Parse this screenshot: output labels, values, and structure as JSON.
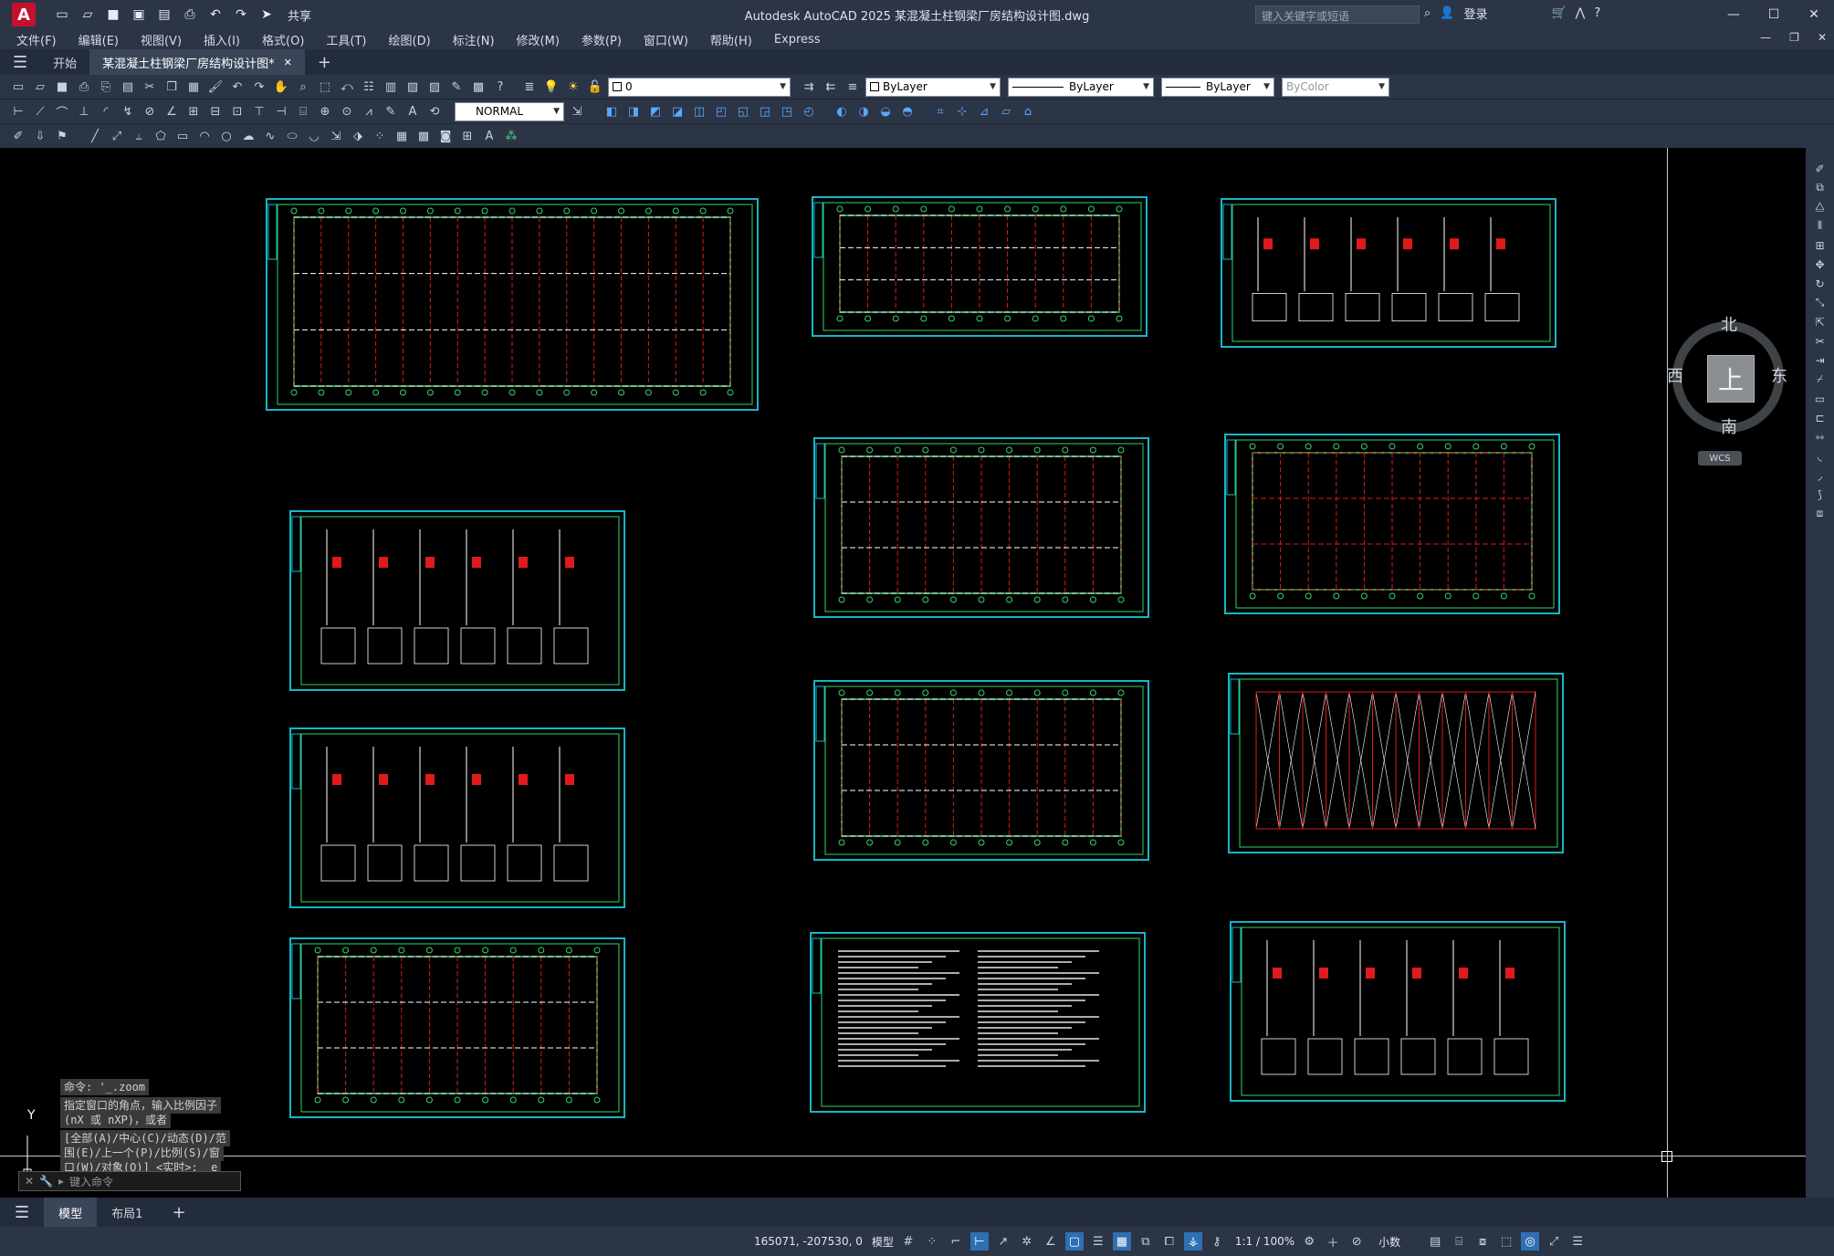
{
  "app": {
    "logo": "A",
    "title": "Autodesk AutoCAD 2025    某混凝土柱钢梁厂房结构设计图.dwg",
    "share_label": "共享",
    "search_placeholder": "键入关键字或短语",
    "login_label": "登录"
  },
  "menu": [
    "文件(F)",
    "编辑(E)",
    "视图(V)",
    "插入(I)",
    "格式(O)",
    "工具(T)",
    "绘图(D)",
    "标注(N)",
    "修改(M)",
    "参数(P)",
    "窗口(W)",
    "帮助(H)",
    "Express"
  ],
  "tabs": {
    "start": "开始",
    "file": "某混凝土柱钢梁厂房结构设计图*",
    "close": "✕",
    "add": "+"
  },
  "properties": {
    "layer_value": "0",
    "color": "ByLayer",
    "linetype": "ByLayer",
    "lineweight": "ByLayer",
    "plotstyle": "ByColor",
    "dimstyle": "NORMAL"
  },
  "viewcube": {
    "north": "北",
    "south": "南",
    "east": "东",
    "west": "西",
    "face": "上",
    "wcs": "WCS"
  },
  "command": {
    "line1": "命令: '_.zoom",
    "line2a": "指定窗口的角点，输入比例因子",
    "line2b": "(nX 或 nXP)，或者",
    "line3a": "[全部(A)/中心(C)/动态(D)/范",
    "line3b": "围(E)/上一个(P)/比例(S)/窗",
    "line3c": "口(W)/对象(O)] <实时>: _e",
    "input_placeholder": "键入命令"
  },
  "ucs": {
    "y": "Y"
  },
  "layouts": {
    "model": "模型",
    "layout1": "布局1",
    "add": "+"
  },
  "status": {
    "coords": "165071, -207530, 0",
    "model": "模型",
    "scale": "1:1 / 100%",
    "units": "小数"
  },
  "colors": {
    "sheet_border": "#17b6c4",
    "grid_green": "#35d46a",
    "axis_red": "#e01a1a",
    "accent": "#2f6fb3"
  }
}
